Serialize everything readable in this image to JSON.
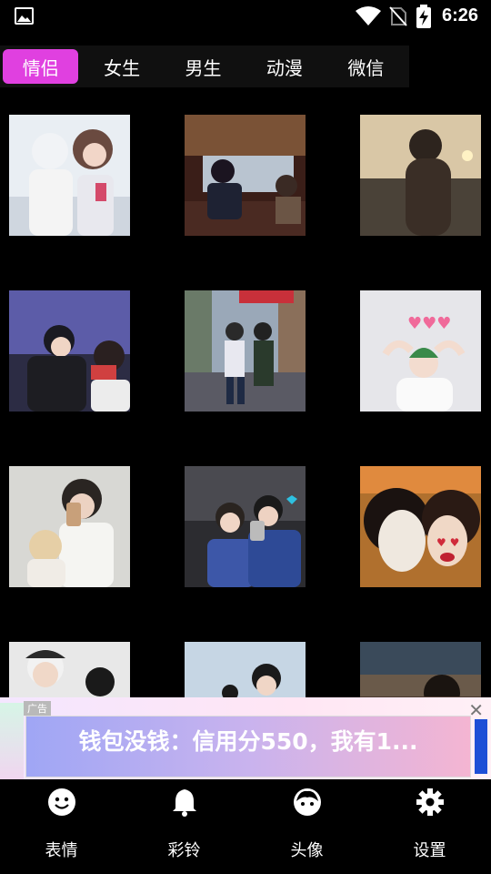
{
  "status_bar": {
    "time": "6:26",
    "icons": [
      "image-icon",
      "wifi-icon",
      "no-sim-icon",
      "battery-charging-icon"
    ]
  },
  "tabs": [
    {
      "label": "情侣",
      "active": true
    },
    {
      "label": "女生",
      "active": false
    },
    {
      "label": "男生",
      "active": false
    },
    {
      "label": "动漫",
      "active": false
    },
    {
      "label": "微信",
      "active": false
    }
  ],
  "grid": {
    "items": [
      {
        "name": "couple-avatar-1"
      },
      {
        "name": "couple-avatar-2"
      },
      {
        "name": "couple-avatar-3"
      },
      {
        "name": "couple-avatar-4"
      },
      {
        "name": "couple-avatar-5"
      },
      {
        "name": "couple-avatar-6"
      },
      {
        "name": "couple-avatar-7"
      },
      {
        "name": "couple-avatar-8"
      },
      {
        "name": "couple-avatar-9"
      },
      {
        "name": "couple-avatar-10"
      },
      {
        "name": "couple-avatar-11"
      },
      {
        "name": "couple-avatar-12"
      }
    ]
  },
  "ad": {
    "badge": "广告",
    "text": "钱包没钱：信用分550，我有1...",
    "close": "✕"
  },
  "bottom_nav": [
    {
      "label": "表情",
      "icon": "smiley-icon",
      "active": false
    },
    {
      "label": "彩铃",
      "icon": "bell-icon",
      "active": false
    },
    {
      "label": "头像",
      "icon": "avatar-face-icon",
      "active": true
    },
    {
      "label": "设置",
      "icon": "gear-icon",
      "active": false
    }
  ],
  "colors": {
    "accent": "#e040e0",
    "background": "#000000",
    "tab_bar": "#101010"
  }
}
